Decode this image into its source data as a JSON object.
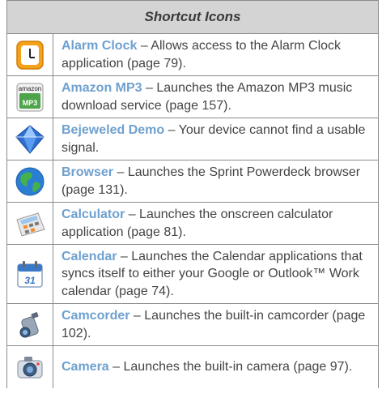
{
  "table": {
    "title": "Shortcut Icons",
    "rows": [
      {
        "icon": "alarm-clock-icon",
        "name": "Alarm Clock",
        "desc": " – Allows access to the Alarm Clock application (page 79)."
      },
      {
        "icon": "amazon-mp3-icon",
        "name": "Amazon MP3",
        "desc": " – Launches the Amazon MP3 music download service (page 157).",
        "icon_top": "amazon",
        "icon_bottom": "MP3"
      },
      {
        "icon": "bejeweled-diamond-icon",
        "name": "Bejeweled Demo",
        "desc": " – Your device cannot find a usable signal."
      },
      {
        "icon": "browser-globe-icon",
        "name": "Browser",
        "desc": " – Launches the Sprint Powerdeck browser (page 131)."
      },
      {
        "icon": "calculator-icon",
        "name": "Calculator",
        "desc": " – Launches the onscreen calculator application (page 81)."
      },
      {
        "icon": "calendar-icon",
        "name": "Calendar",
        "desc": " – Launches the Calendar applications that syncs itself to either your Google or Outlook™ Work calendar (page 74).",
        "icon_text": "31"
      },
      {
        "icon": "camcorder-icon",
        "name": "Camcorder",
        "desc": " – Launches the built-in camcorder (page 102)."
      },
      {
        "icon": "camera-icon",
        "name": "Camera",
        "desc": " – Launches the built-in camera (page 97)."
      }
    ]
  }
}
